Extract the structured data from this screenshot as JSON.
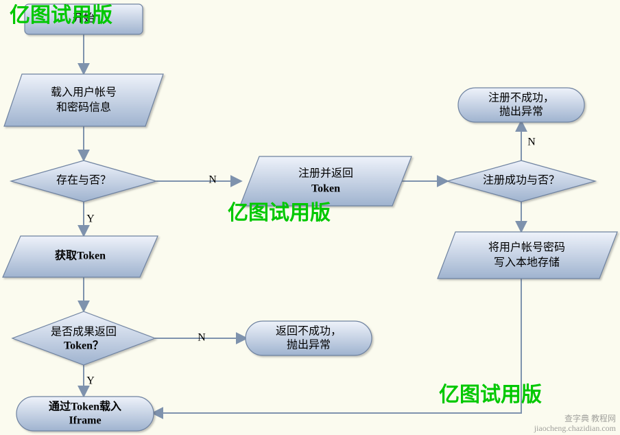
{
  "nodes": {
    "start": "开始",
    "load_l1": "载入用户帐号",
    "load_l2": "和密码信息",
    "exists": "存在与否？",
    "get_token": "获取Token",
    "got_token_l1": "是否成果返回",
    "got_token_l2": "Token？",
    "reg_ret_l1": "注册并返回",
    "reg_ret_l2": "Token",
    "reg_ok": "注册成功与否？",
    "store_l1": "将用户帐号密码",
    "store_l2": "写入本地存储",
    "reg_fail_l1": "注册不成功，",
    "reg_fail_l2": "抛出异常",
    "ret_fail_l1": "返回不成功，",
    "ret_fail_l2": "抛出异常",
    "iframe_l1": "通过Token载入",
    "iframe_l2": "Iframe"
  },
  "edges": {
    "yes": "Y",
    "no": "N"
  },
  "watermark": "亿图试用版",
  "footer_l1": "查字典 教程网",
  "footer_l2": "jiaocheng.chazidian.com"
}
